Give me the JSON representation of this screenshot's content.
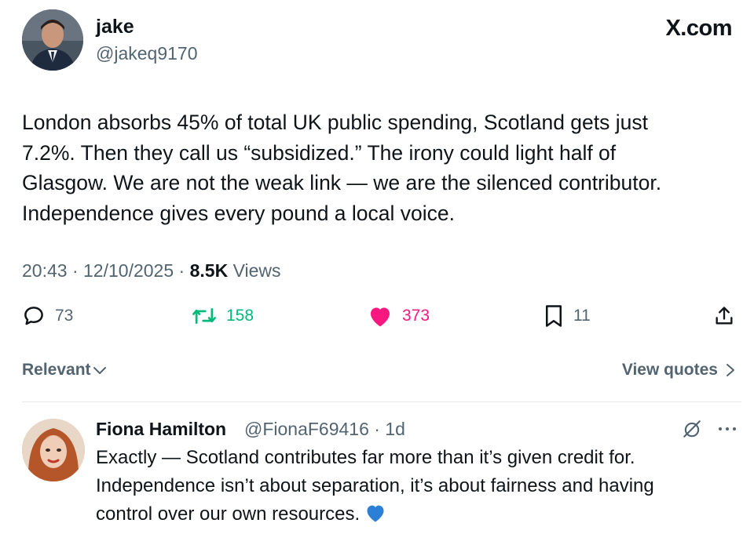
{
  "tweet": {
    "author_name": "jake",
    "author_handle": "@jakeq9170",
    "brand": "X.com",
    "text": "London absorbs 45% of total UK public spending, Scotland gets just\n7.2%. Then they call us “subsidized.” The irony could light half of\nGlasgow. We are not the weak link — we are the silenced contributor.\nIndependence gives every pound a local voice.",
    "time": "20:43",
    "date": "12/10/2025",
    "views_count": "8.5K",
    "views_label": "Views"
  },
  "actions": {
    "replies": "73",
    "reposts": "158",
    "likes": "373",
    "bookmarks": "11"
  },
  "controls": {
    "sort_label": "Relevant",
    "view_quotes_label": "View quotes"
  },
  "reply": {
    "name": "Fiona Hamilton",
    "handle": "@FionaF69416",
    "age": "1d",
    "text": "Exactly — Scotland contributes far more than it’s given credit for.\nIndependence isn’t about separation, it’s about fairness and having\ncontrol over our own resources."
  },
  "colors": {
    "text": "#0f1419",
    "muted": "#536471",
    "repost": "#00ba7c",
    "like": "#f91880",
    "divider": "#e6e9ec"
  },
  "icons": {
    "reply": "comment-icon",
    "repost": "repost-icon",
    "like": "heart-icon",
    "bookmark": "bookmark-icon",
    "share": "share-icon",
    "emoji": "blue-heart-emoji"
  }
}
